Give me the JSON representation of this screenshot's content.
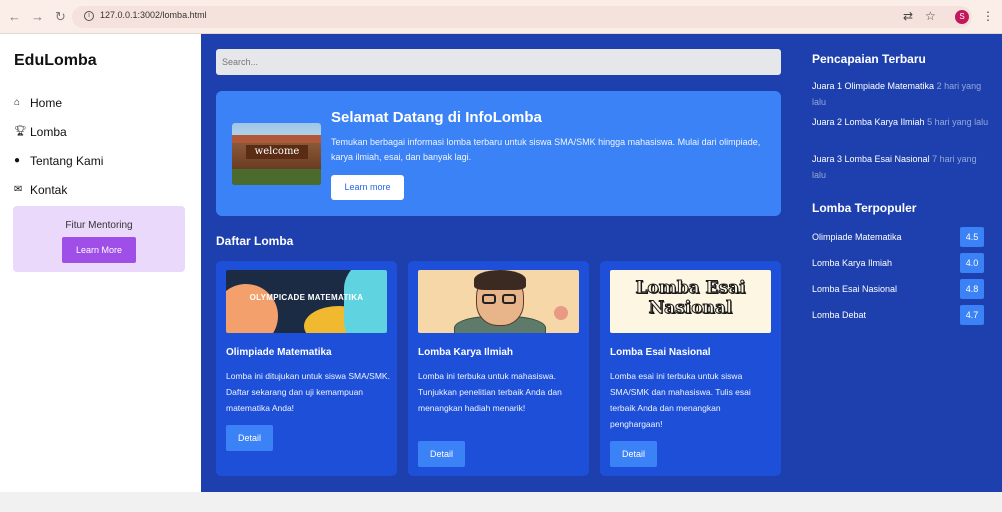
{
  "browser": {
    "url": "127.0.0.1:3002/lomba.html",
    "profile_initial": "S"
  },
  "sidebar": {
    "brand": "EduLomba",
    "items": [
      {
        "label": "Home",
        "icon": "home-icon"
      },
      {
        "label": "Lomba",
        "icon": "trophy-icon"
      },
      {
        "label": "Tentang Kami",
        "icon": "info-icon"
      },
      {
        "label": "Kontak",
        "icon": "envelope-icon"
      }
    ],
    "mentor": {
      "title": "Fitur Mentoring",
      "button": "Learn More"
    }
  },
  "main": {
    "search_placeholder": "Search...",
    "hero": {
      "title": "Selamat Datang di InfoLomba",
      "text": "Temukan berbagai informasi lomba terbaru untuk siswa SMA/SMK hingga mahasiswa. Mulai dari olimpiade, karya ilmiah, esai, dan banyak lagi.",
      "button": "Learn more",
      "image_text": "welcome"
    },
    "section_title": "Daftar Lomba",
    "cards": [
      {
        "image_text": "OLYMPICADE MATEMATIKA",
        "title": "Olimpiade Matematika",
        "text": "Lomba ini ditujukan untuk siswa SMA/SMK. Daftar sekarang dan uji kemampuan matematika Anda!",
        "button": "Detail"
      },
      {
        "image_text": "",
        "title": "Lomba Karya Ilmiah",
        "text": "Lomba ini terbuka untuk mahasiswa. Tunjukkan penelitian terbaik Anda dan menangkan hadiah menarik!",
        "button": "Detail"
      },
      {
        "image_text": "Lomba Esai Nasional",
        "title": "Lomba Esai Nasional",
        "text": "Lomba esai ini terbuka untuk siswa SMA/SMK dan mahasiswa. Tulis esai terbaik Anda dan menangkan penghargaan!",
        "button": "Detail"
      }
    ]
  },
  "right": {
    "achievements_title": "Pencapaian Terbaru",
    "achievements": [
      {
        "text": "Juara 1 Olimpiade Matematika",
        "time": "2 hari yang lalu"
      },
      {
        "text": "Juara 2 Lomba Karya Ilmiah",
        "time": "5 hari yang lalu"
      },
      {
        "text": "Juara 3 Lomba Esai Nasional",
        "time": "7 hari yang lalu"
      }
    ],
    "popular_title": "Lomba Terpopuler",
    "popular": [
      {
        "name": "Olimpiade Matematika",
        "score": "4.5"
      },
      {
        "name": "Lomba Karya Ilmiah",
        "score": "4.0"
      },
      {
        "name": "Lomba Esai Nasional",
        "score": "4.8"
      },
      {
        "name": "Lomba Debat",
        "score": "4.7"
      }
    ]
  }
}
